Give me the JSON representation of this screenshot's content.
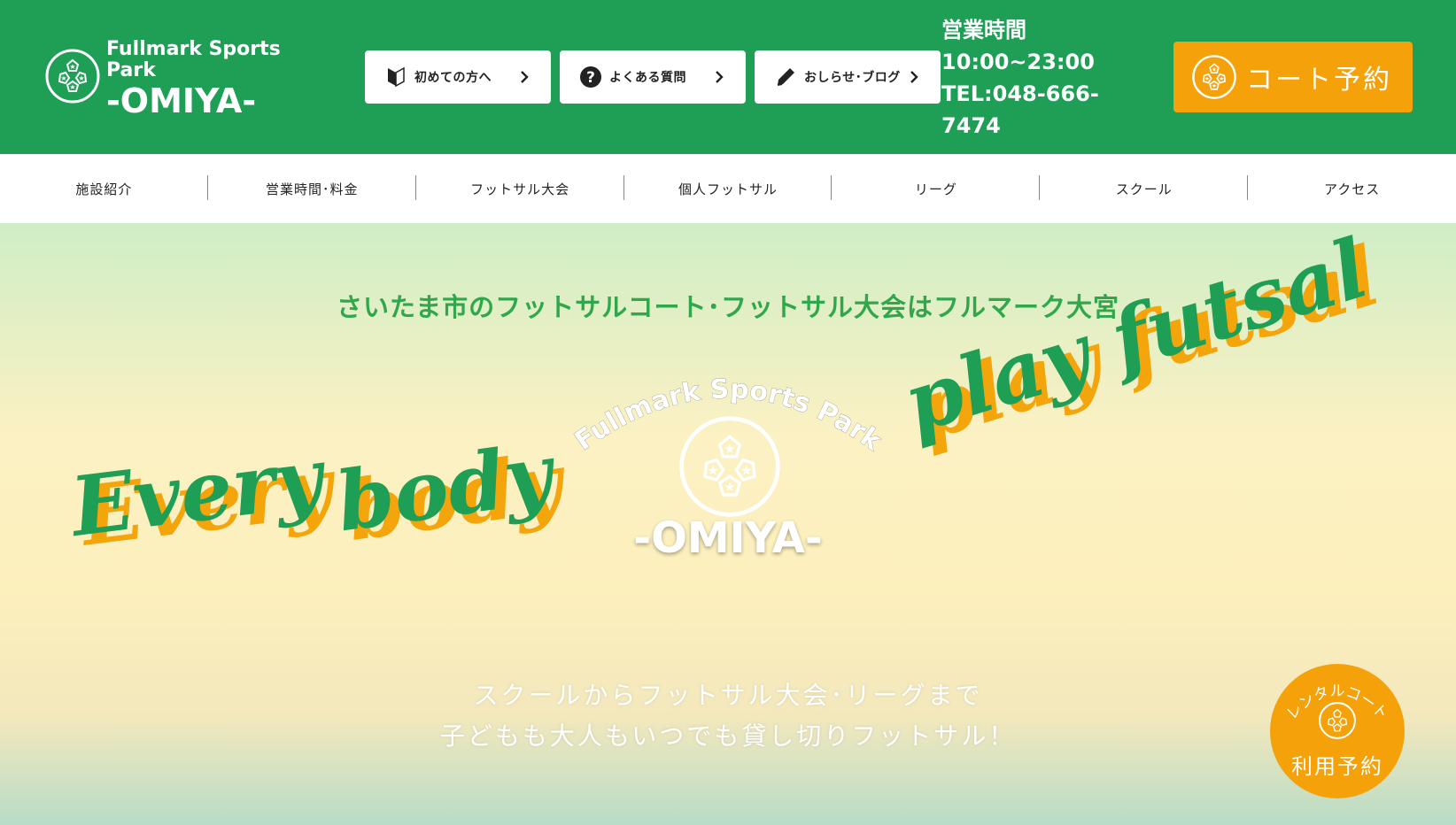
{
  "header": {
    "logo": {
      "line1": "Fullmark Sports",
      "line2": "Park",
      "line3": "-OMIYA-"
    },
    "buttons": [
      {
        "label": "初めての方へ",
        "icon": "beginner-mark-icon"
      },
      {
        "label": "よくある質問",
        "icon": "question-circle-icon"
      },
      {
        "label": "おしらせ･ブログ",
        "icon": "pencil-icon"
      }
    ],
    "hours": {
      "label": "営業時間",
      "time": "10:00~23:00",
      "tel": "TEL:048-666-7474"
    },
    "reserve": {
      "label": "コート予約",
      "icon": "soccer-ball-icon"
    }
  },
  "nav": {
    "items": [
      "施設紹介",
      "営業時間･料金",
      "フットサル大会",
      "個人フットサル",
      "リーグ",
      "スクール",
      "アクセス"
    ]
  },
  "hero": {
    "tagline": "さいたま市のフットサルコート･フットサル大会はフルマーク大宮",
    "script_left_1": "Every",
    "script_left_2": "body",
    "script_right": "play futsal",
    "center_logo": {
      "arc_text": "Fullmark Sports Park",
      "name": "-OMIYA-"
    },
    "subtitle_1": "スクールからフットサル大会･リーグまで",
    "subtitle_2": "子どもも大人もいつでも貸し切りフットサル！"
  },
  "float_button": {
    "arc_text": "レンタルコート",
    "label": "利用予約"
  },
  "colors": {
    "primary_green": "#1f9e55",
    "accent_orange": "#f5a10a",
    "tagline_green": "#2ea84a"
  }
}
